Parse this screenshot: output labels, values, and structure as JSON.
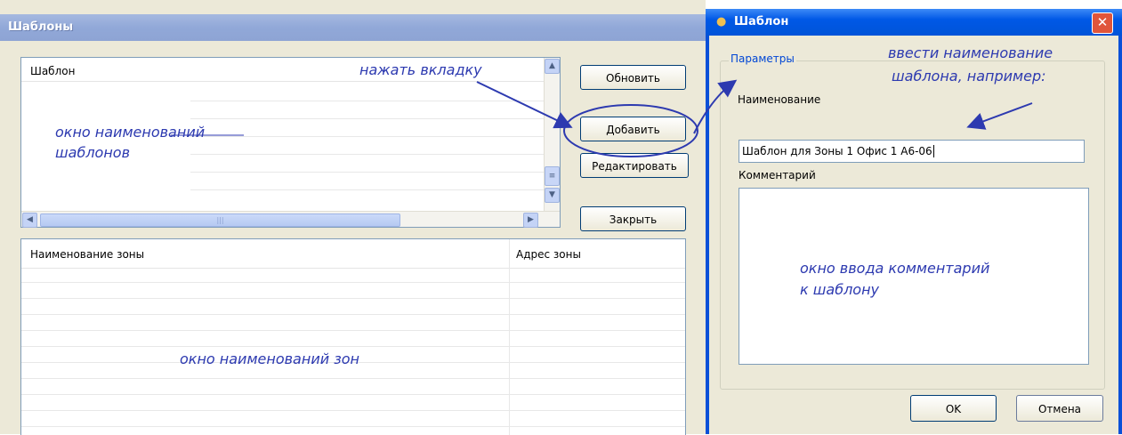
{
  "templates_window": {
    "title": "Шаблоны",
    "templates_grid": {
      "column_header": "Шаблон"
    },
    "buttons": {
      "refresh": "Обновить",
      "add": "Добавить",
      "edit": "Редактировать",
      "close": "Закрыть"
    },
    "zones_grid": {
      "col_name": "Наименование зоны",
      "col_address": "Адрес зоны"
    }
  },
  "template_dialog": {
    "title": "Шаблон",
    "group_label": "Параметры",
    "name_label": "Наименование",
    "name_value": "Шаблон для Зоны 1 Офис 1 А6-06",
    "comment_label": "Комментарий",
    "ok_label": "OK",
    "cancel_label": "Отмена"
  },
  "annotations": {
    "press_tab": "нажать вкладку",
    "templates_names_window_1": "окно наименований",
    "templates_names_window_2": "шаблонов",
    "enter_name_1": "ввести наименование",
    "enter_name_2": "шаблона, например:",
    "comment_window_1": "окно ввода комментарий",
    "comment_window_2": "к шаблону",
    "zones_window": "окно наименований зон"
  },
  "colors": {
    "annotation": "#2d3ab0",
    "dialog_title_bar": "#0058e6",
    "left_title_bar": "#91a8d8"
  },
  "icons": [
    "close-icon",
    "scroll-up-icon",
    "scroll-down-icon",
    "scroll-left-icon",
    "scroll-right-icon",
    "app-icon"
  ]
}
